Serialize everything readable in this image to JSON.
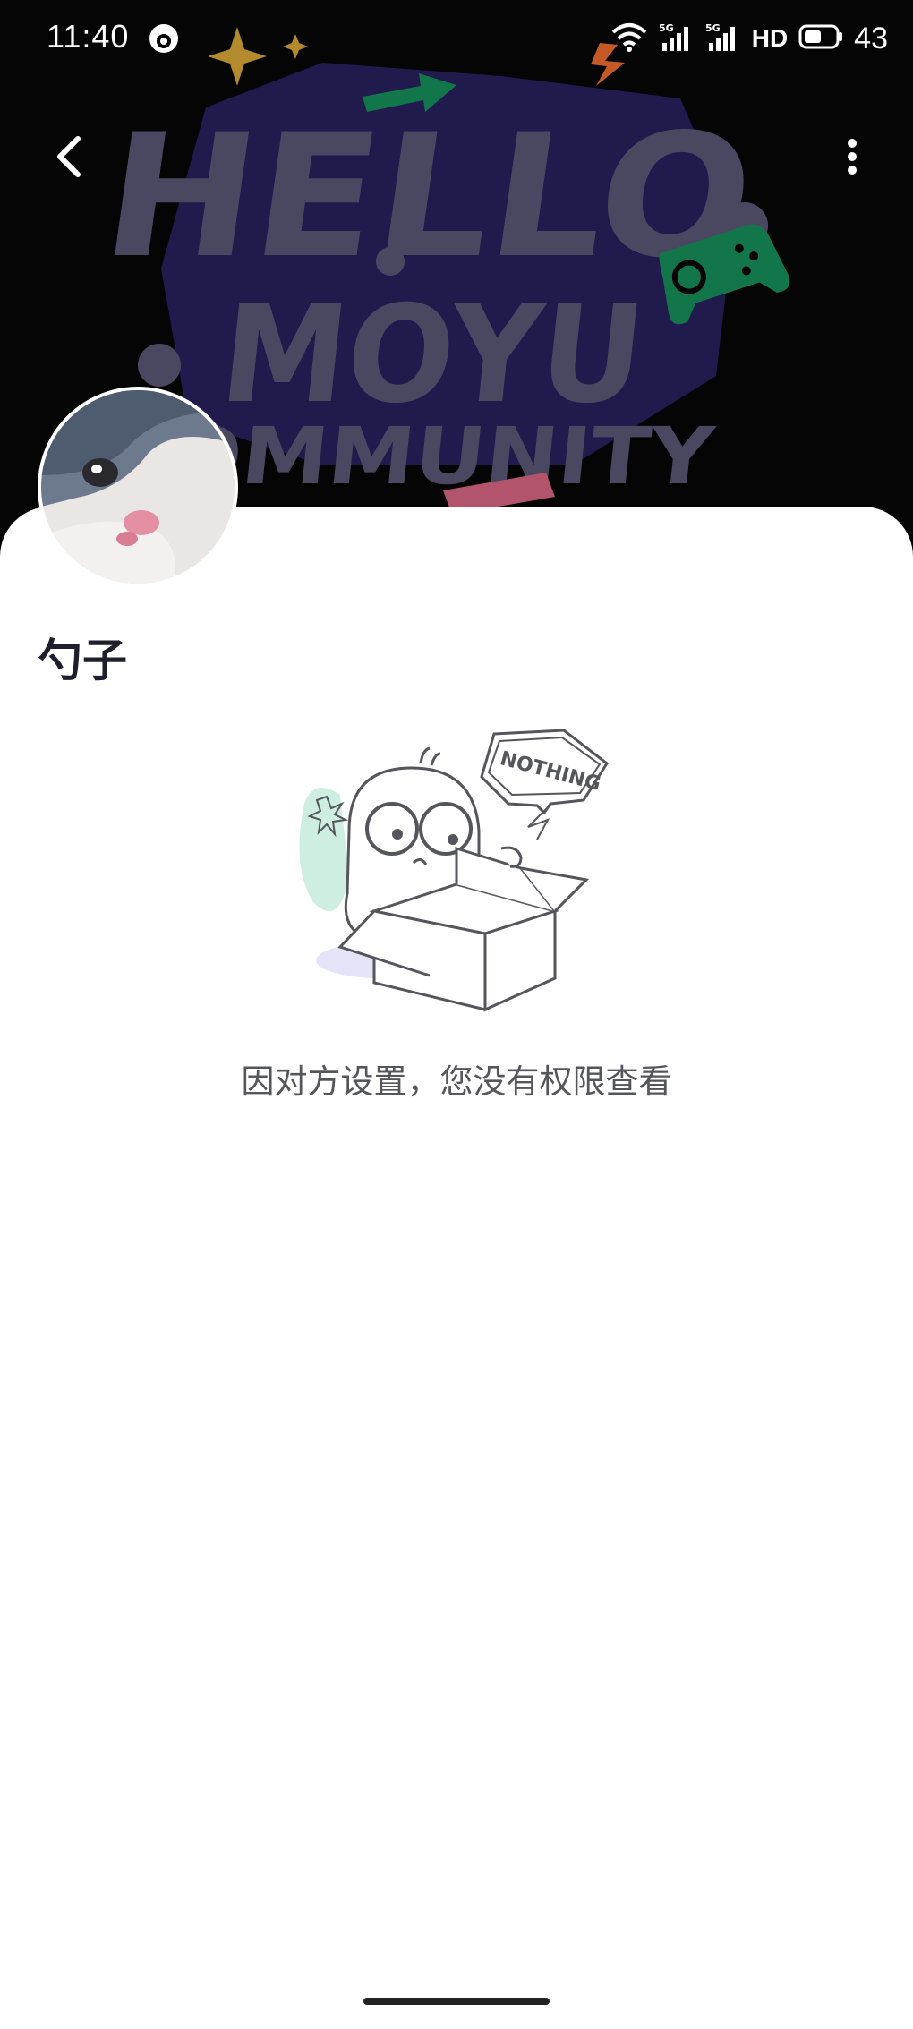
{
  "status_bar": {
    "time": "11:40",
    "network": "5G",
    "hd_label": "HD",
    "battery": "43"
  },
  "banner": {
    "line1": "HELLO",
    "line2": "MOYU",
    "line3": "COMMUNITY"
  },
  "profile": {
    "username": "勺子"
  },
  "empty_state": {
    "badge_text": "NOTHING",
    "message": "因对方设置，您没有权限查看"
  },
  "colors": {
    "banner_bg": "#050505",
    "banner_text": "#4a4860",
    "banner_shape": "#201a4d",
    "accent_green": "#13764a",
    "accent_gold": "#b38a2c",
    "accent_pink": "#b2556c"
  }
}
